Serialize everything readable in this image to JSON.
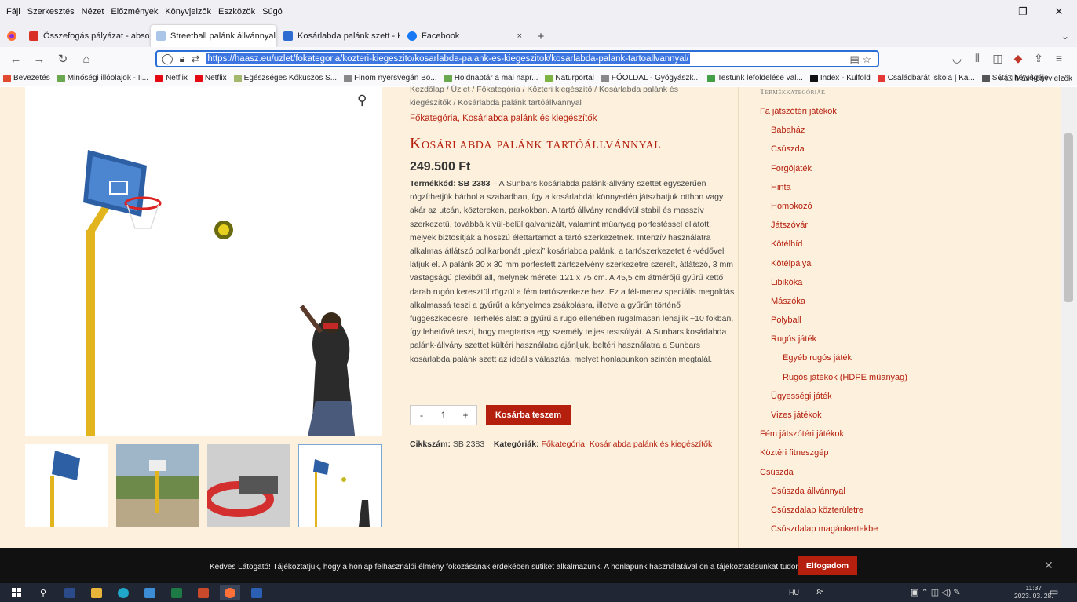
{
  "menu": [
    "Fájl",
    "Szerkesztés",
    "Nézet",
    "Előzmények",
    "Könyvjelzők",
    "Eszközök",
    "Súgó"
  ],
  "window_controls": [
    "–",
    "❐",
    "✕"
  ],
  "tabs": [
    {
      "title": "Összefogás pályázat - absolutvil",
      "color": "#d93025"
    },
    {
      "title": "Streetball palánk állvánnyal - Ko",
      "color": "#a9c6e8",
      "active": true
    },
    {
      "title": "Kosárlabda palánk szett - Kapu, ;",
      "color": "#2d6bd0"
    },
    {
      "title": "Facebook",
      "color": "#1877f2"
    }
  ],
  "tab_close": "×",
  "new_tab": "+",
  "url": "https://haasz.eu/uzlet/fokategoria/kozteri-kiegeszito/kosarlabda-palank-es-kiegeszitok/kosarlabda-palank-tartoallvannyal/",
  "bookmarks": [
    {
      "label": "Bevezetés",
      "color": "#e04a2f"
    },
    {
      "label": "Minőségi illóolajok - Il...",
      "color": "#6aa84f"
    },
    {
      "label": "Netflix",
      "color": "#e50914"
    },
    {
      "label": "Netflix",
      "color": "#e50914"
    },
    {
      "label": "Egészséges Kókuszos S...",
      "color": "#a3b86c"
    },
    {
      "label": "Finom nyersvegán Bo...",
      "color": "#888888"
    },
    {
      "label": "Holdnaptár a mai napr...",
      "color": "#6aa84f"
    },
    {
      "label": "Naturportal",
      "color": "#7cb342"
    },
    {
      "label": "FŐOLDAL - Gyógyászk...",
      "color": "#888888"
    },
    {
      "label": "Testünk leföldelése val...",
      "color": "#43a047"
    },
    {
      "label": "Index - Külföld",
      "color": "#111111"
    },
    {
      "label": "Családbarát iskola | Ka...",
      "color": "#e53935"
    },
    {
      "label": "Séták hétvégéje",
      "color": "#555555"
    }
  ],
  "bookmarks_other": "Más könyvjelzők",
  "product": {
    "breadcrumb_line1": "Kezdőlap / Üzlet / Főkategória / Közteri kiegészítő / Kosárlabda palánk és",
    "breadcrumb_line2": "kiegészítők / Kosárlabda palánk tartóállvánnyal",
    "categories": "Főkategória, Kosárlabda palánk és kiegészítők",
    "title": "Kosárlabda palánk tartóállvánnyal",
    "price": "249.500 Ft",
    "code_label": "Termékkód: SB 2383",
    "description": " – A Sunbars kosárlabda palánk-állvány szettet egyszerűen rögzíthetjük bárhol a szabadban, így a kosárlabdát könnyedén játszhatjuk otthon vagy akár az utcán, köztereken, parkokban. A tartó állvány rendkívül stabil és masszív szerkezetű, továbbá kívül-belül galvanizált, valamint műanyag porfestéssel ellátott, melyek biztosítják a hosszú élettartamot a tartó szerkezetnek. Intenzív használatra alkalmas átlátszó polikarbonát „plexi” kosárlabda palánk, a tartószerkezetet él-védővel látjuk el. A palánk 30 x 30 mm porfestett zártszelvény szerkezetre szerelt, átlátszó, 3 mm vastagságú plexiből áll, melynek méretei 121 x 75 cm. A 45,5 cm átmérőjű gyűrű kettő darab rugón keresztül rögzül a fém tartószerkezethez. Ez a fél-merev speciális megoldás alkalmassá teszi a gyűrűt a kényelmes zsákolásra, illetve a gyűrűn történő függeszkedésre. Terhelés alatt a gyűrű a rugó ellenében rugalmasan lehajlik ~10 fokban, így lehetővé teszi, hogy megtartsa egy személy teljes testsúlyát. A Sunbars kosárlabda palánk-állvány szettet kültéri használatra ajánljuk, beltéri használatra a Sunbars kosárlabda palánk szett az ideális választás, melyet honlapunkon szintén megtalál.",
    "qty_minus": "-",
    "qty_value": "1",
    "qty_plus": "+",
    "cart_button": "Kosárba teszem",
    "sku_label": "Cikkszám:",
    "sku": "SB 2383",
    "cat_label": "Kategóriák:",
    "cat_values": "Főkategória, Kosárlabda palánk és kiegészítők"
  },
  "sidebar": {
    "heading": "Termékkategóriák",
    "items": [
      {
        "label": "Fa játszótéri játékok",
        "level": 1
      },
      {
        "label": "Babaház",
        "level": 2
      },
      {
        "label": "Csúszda",
        "level": 2
      },
      {
        "label": "Forgójáték",
        "level": 2
      },
      {
        "label": "Hinta",
        "level": 2
      },
      {
        "label": "Homokozó",
        "level": 2
      },
      {
        "label": "Játszóvár",
        "level": 2
      },
      {
        "label": "Kötélhíd",
        "level": 2
      },
      {
        "label": "Kötélpálya",
        "level": 2
      },
      {
        "label": "Libikóka",
        "level": 2
      },
      {
        "label": "Mászóka",
        "level": 2
      },
      {
        "label": "Polyball",
        "level": 2
      },
      {
        "label": "Rugós játék",
        "level": 2
      },
      {
        "label": "Egyéb rugós játék",
        "level": 3
      },
      {
        "label": "Rugós játékok (HDPE műanyag)",
        "level": 3
      },
      {
        "label": "Ügyességi játék",
        "level": 2
      },
      {
        "label": "Vizes játékok",
        "level": 2
      },
      {
        "label": "Fém játszótéri játékok",
        "level": 1
      },
      {
        "label": "Köztéri fitneszgép",
        "level": 1
      },
      {
        "label": "Csúszda",
        "level": 1
      },
      {
        "label": "Csúszda állvánnyal",
        "level": 2
      },
      {
        "label": "Csúszdalap közterületre",
        "level": 2
      },
      {
        "label": "Csúszdalap magánkertekbe",
        "level": 2
      }
    ]
  },
  "cookie": {
    "text": "Kedves Látogató! Tájékoztatjuk, hogy a honlap felhasználói élmény fokozásának érdekében sütiket alkalmazunk. A honlapunk használatával ön a tájékoztatásunkat tudomásul veszi.",
    "button": "Elfogadom",
    "close": "✕"
  },
  "taskbar": {
    "lang": "HU",
    "time": "11:37",
    "date": "2023. 03. 28."
  }
}
